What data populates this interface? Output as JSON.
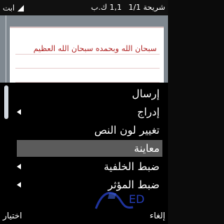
{
  "status": {
    "input_mode": "ابت",
    "message_size": "1,1 ك.ب",
    "page": "شريحة 1/1"
  },
  "document": {
    "text": "سبحان الله وبحمده سبحان الله العظيم"
  },
  "menu": {
    "items": [
      {
        "label": "إرسال",
        "has_submenu": false,
        "selected": false
      },
      {
        "label": "إدراج",
        "has_submenu": true,
        "selected": false
      },
      {
        "label": "تغيير لون النص",
        "has_submenu": false,
        "selected": false
      },
      {
        "label": "معاينة",
        "has_submenu": false,
        "selected": true
      },
      {
        "label": "ضبط الخلفية",
        "has_submenu": true,
        "selected": false
      },
      {
        "label": "ضبط المؤثر",
        "has_submenu": true,
        "selected": false
      }
    ]
  },
  "softkeys": {
    "left": "اختيار",
    "right": "إلغاء"
  },
  "watermark": {
    "text": "ED"
  },
  "colors": {
    "menu_highlight": "#5b5b5b",
    "workspace": "#7f8890",
    "document_text": "#b02424"
  }
}
